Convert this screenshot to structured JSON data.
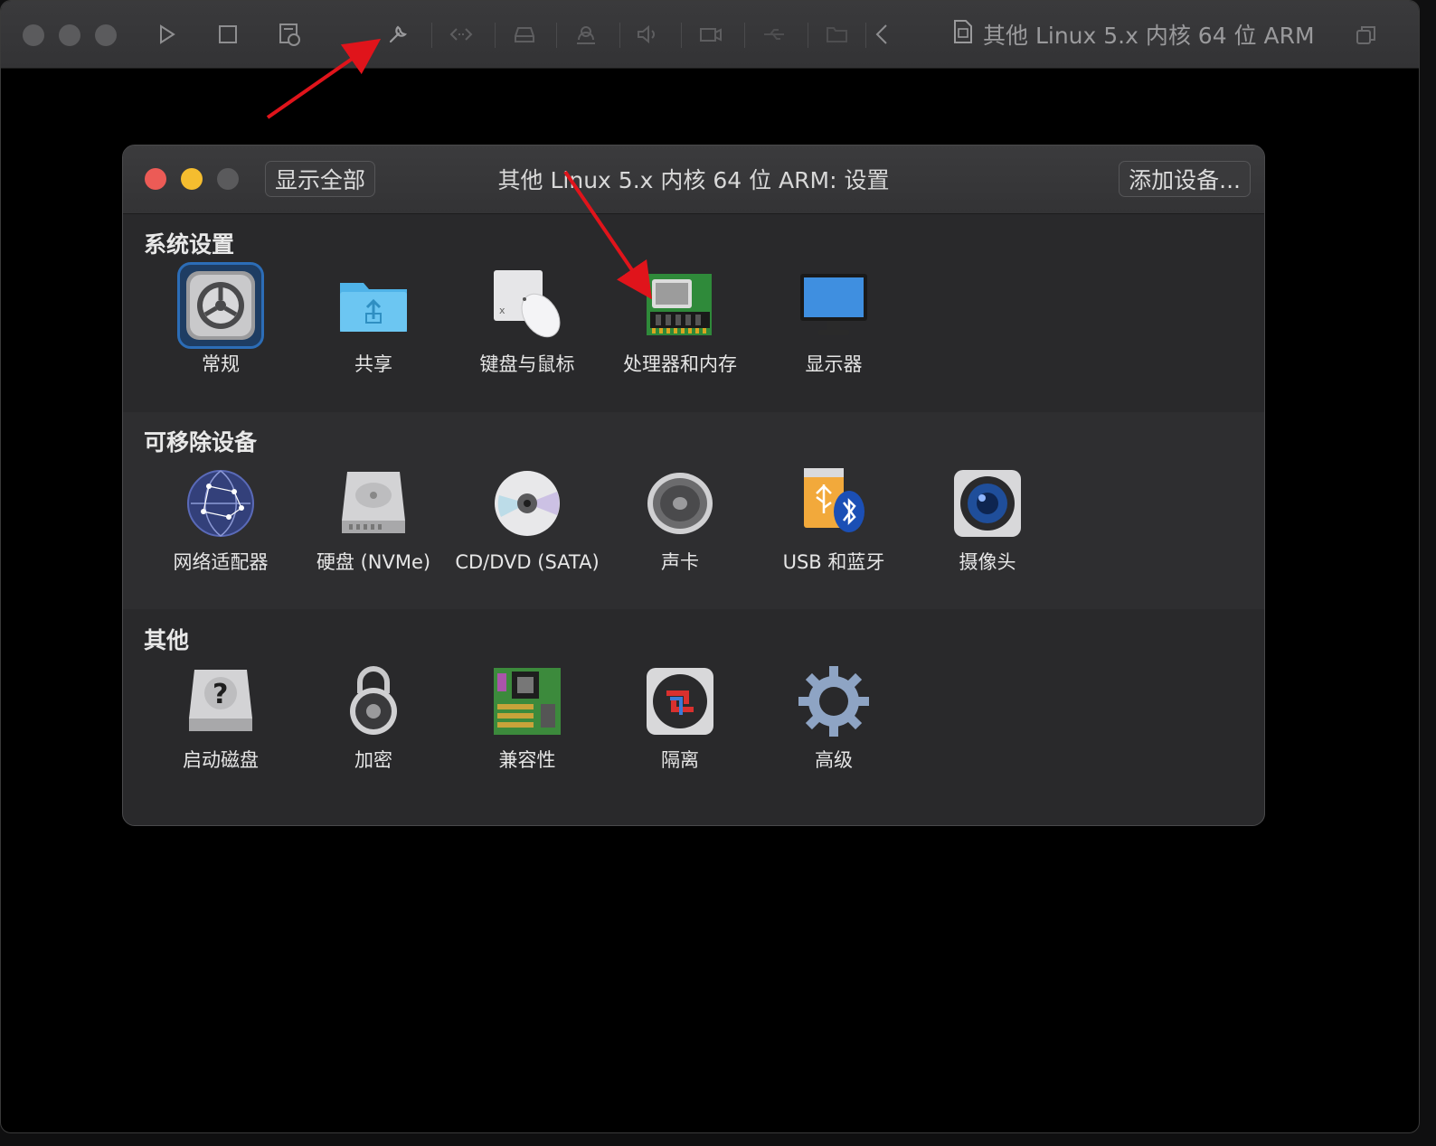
{
  "vm_window": {
    "title": "其他 Linux 5.x 内核 64 位 ARM",
    "toolbar_icons": [
      "play-icon",
      "stop-icon",
      "snapshot-icon",
      "wrench-icon",
      "code-icon",
      "disk-icon",
      "user-icon",
      "volume-icon",
      "camera-icon",
      "usb-icon",
      "share-folder-icon",
      "chevron-left-icon"
    ]
  },
  "dialog": {
    "title": "其他 Linux 5.x 内核 64 位 ARM: 设置",
    "show_all_label": "显示全部",
    "add_device_label": "添加设备...",
    "sections": [
      {
        "title": "系统设置",
        "items": [
          {
            "label": "常规",
            "icon": "gear-icon",
            "selected": true
          },
          {
            "label": "共享",
            "icon": "shared-folder-icon"
          },
          {
            "label": "键盘与鼠标",
            "icon": "keyboard-mouse-icon"
          },
          {
            "label": "处理器和内存",
            "icon": "memory-chip-icon"
          },
          {
            "label": "显示器",
            "icon": "monitor-icon"
          }
        ]
      },
      {
        "title": "可移除设备",
        "items": [
          {
            "label": "网络适配器",
            "icon": "network-globe-icon"
          },
          {
            "label": "硬盘 (NVMe)",
            "icon": "hard-disk-icon"
          },
          {
            "label": "CD/DVD (SATA)",
            "icon": "cd-dvd-icon"
          },
          {
            "label": "声卡",
            "icon": "speaker-icon"
          },
          {
            "label": "USB 和蓝牙",
            "icon": "usb-bluetooth-icon"
          },
          {
            "label": "摄像头",
            "icon": "camera-lens-icon"
          }
        ]
      },
      {
        "title": "其他",
        "items": [
          {
            "label": "启动磁盘",
            "icon": "startup-disk-icon"
          },
          {
            "label": "加密",
            "icon": "lock-icon"
          },
          {
            "label": "兼容性",
            "icon": "motherboard-icon"
          },
          {
            "label": "隔离",
            "icon": "isolation-icon"
          },
          {
            "label": "高级",
            "icon": "advanced-gear-icon"
          }
        ]
      }
    ]
  },
  "colors": {
    "selection": "#2c6db7",
    "annotation_arrow": "#e0141b",
    "close": "#ec5b56",
    "minimize": "#f5bd2f"
  }
}
